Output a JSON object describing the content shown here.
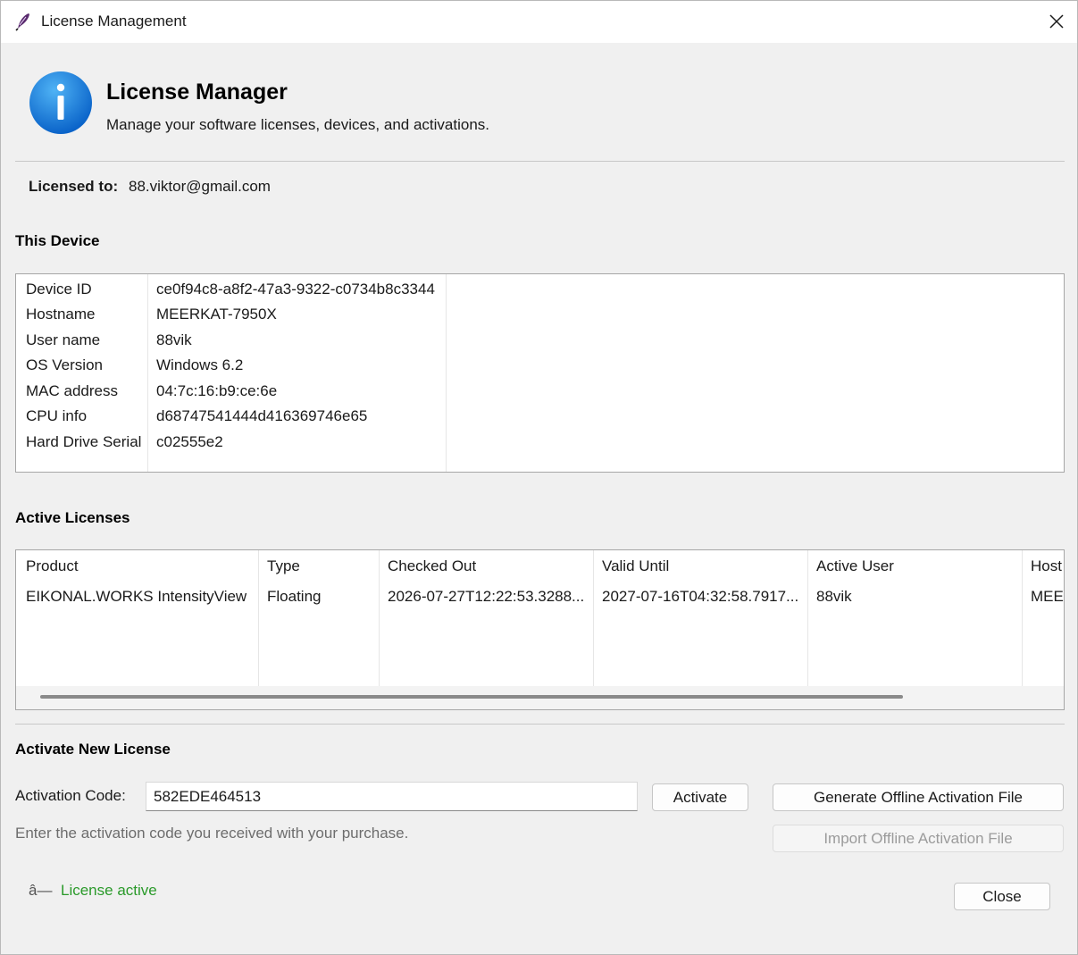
{
  "window": {
    "title": "License Management",
    "close_glyph": "✕"
  },
  "header": {
    "icon": "info-icon",
    "title": "License Manager",
    "subtitle": "Manage your software licenses, devices, and activations."
  },
  "licensed_to": {
    "label": "Licensed to:",
    "value": "88.viktor@gmail.com"
  },
  "this_device": {
    "title": "This Device",
    "rows": [
      {
        "label": "Device ID",
        "value": "ce0f94c8-a8f2-47a3-9322-c0734b8c3344"
      },
      {
        "label": "Hostname",
        "value": "MEERKAT-7950X"
      },
      {
        "label": "User name",
        "value": "88vik"
      },
      {
        "label": "OS Version",
        "value": "Windows 6.2"
      },
      {
        "label": "MAC address",
        "value": "04:7c:16:b9:ce:6e"
      },
      {
        "label": "CPU info",
        "value": "d68747541444d416369746e65"
      },
      {
        "label": "Hard Drive Serial",
        "value": "c02555e2"
      }
    ]
  },
  "active_licenses": {
    "title": "Active Licenses",
    "columns": [
      "Product",
      "Type",
      "Checked Out",
      "Valid Until",
      "Active User",
      "Host"
    ],
    "rows": [
      [
        "EIKONAL.WORKS IntensityView",
        "Floating",
        "2026-07-27T12:22:53.3288...",
        "2027-07-16T04:32:58.7917...",
        "88vik",
        "MEE"
      ]
    ]
  },
  "activate": {
    "title": "Activate New License",
    "code_label": "Activation Code:",
    "code_value": "582EDE464513",
    "activate_button": "Activate",
    "generate_button": "Generate Offline Activation File",
    "import_button": "Import Offline Activation File",
    "hint": "Enter the activation code you received with your purchase."
  },
  "status": {
    "glyph": "â—",
    "text": "License active",
    "color": "#2a9a2a"
  },
  "close_button": "Close"
}
